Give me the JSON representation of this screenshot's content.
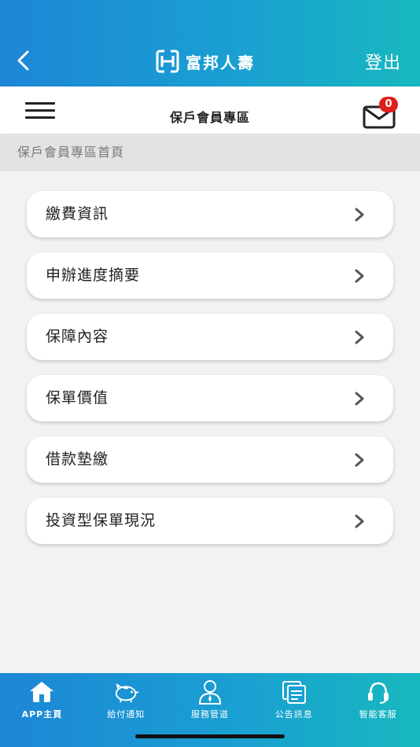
{
  "header": {
    "brand_name": "富邦人壽",
    "logout_label": "登出"
  },
  "subheader": {
    "title": "保戶會員專區",
    "mail_badge_count": "0"
  },
  "breadcrumb": "保戶會員專區首頁",
  "menu": {
    "items": [
      {
        "label": "繳費資訊"
      },
      {
        "label": "申辦進度摘要"
      },
      {
        "label": "保障內容"
      },
      {
        "label": "保單價值"
      },
      {
        "label": "借款墊繳"
      },
      {
        "label": "投資型保單現況"
      }
    ]
  },
  "tabbar": {
    "tabs": [
      {
        "label": "APP主頁",
        "icon": "home-icon",
        "active": true
      },
      {
        "label": "給付通知",
        "icon": "piggy-bank-icon",
        "active": false
      },
      {
        "label": "服務管道",
        "icon": "service-agent-icon",
        "active": false
      },
      {
        "label": "公告訊息",
        "icon": "announcement-icon",
        "active": false
      },
      {
        "label": "智能客服",
        "icon": "headset-icon",
        "active": false
      }
    ]
  },
  "colors": {
    "brand_gradient_start": "#1d86d6",
    "brand_gradient_end": "#17b8bf",
    "badge": "#e01c1c"
  }
}
